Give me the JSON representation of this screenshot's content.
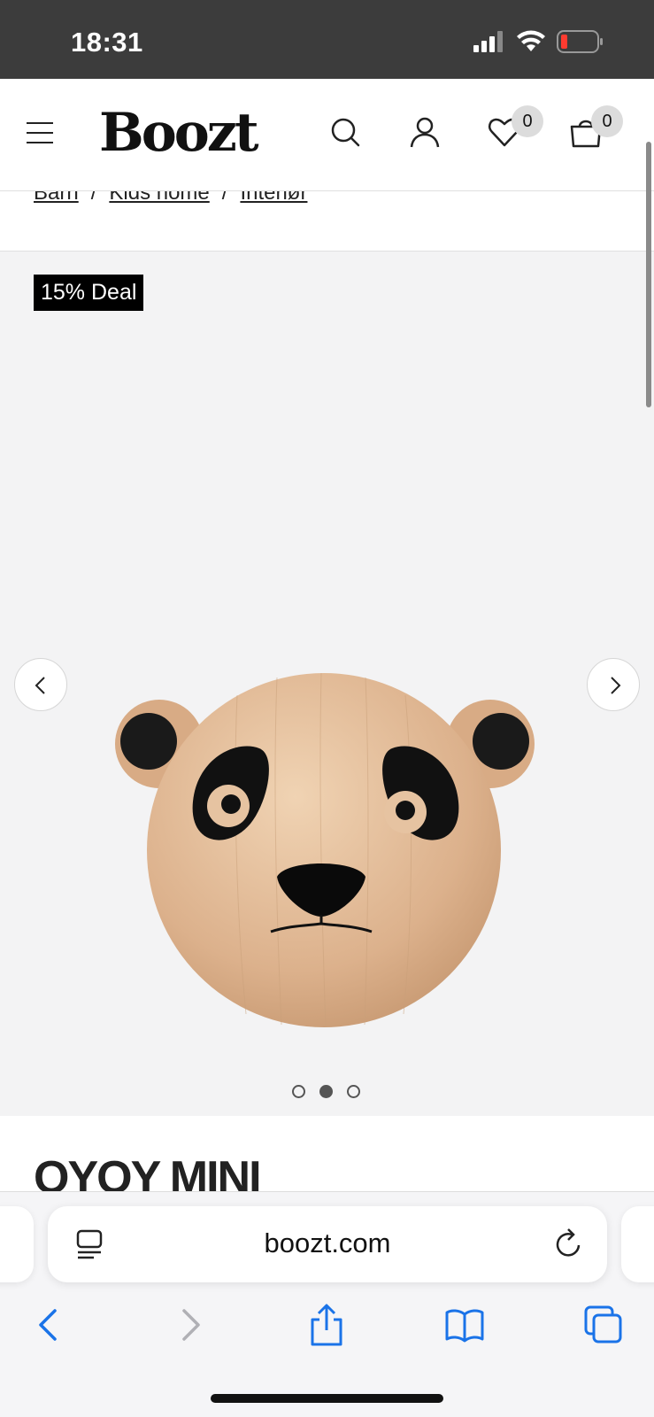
{
  "status_bar": {
    "time": "18:31"
  },
  "header": {
    "logo": "Boozt",
    "wishlist_count": "0",
    "cart_count": "0"
  },
  "breadcrumb": {
    "items": [
      "Barn",
      "Kids home",
      "Interiør"
    ],
    "separator": "/"
  },
  "product": {
    "deal_badge": "15% Deal",
    "title": "OYOY MINI",
    "image_count": 3,
    "active_image_index": 1
  },
  "browser": {
    "url": "boozt.com"
  },
  "colors": {
    "status_bar_bg": "#3c3c3c",
    "accent_ios_blue": "#1a73e8",
    "deal_badge_bg": "#000000"
  }
}
